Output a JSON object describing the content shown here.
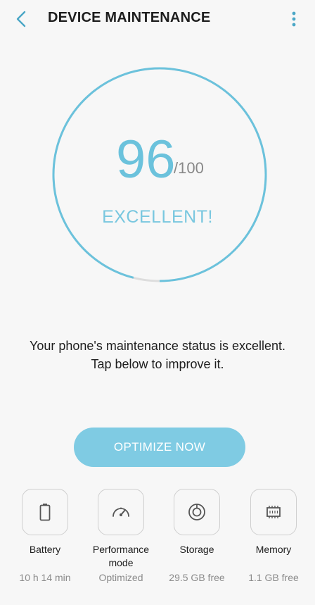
{
  "header": {
    "title": "DEVICE MAINTENANCE",
    "back_icon": "chevron-left-icon",
    "more_icon": "more-vert-icon"
  },
  "score": {
    "value": "96",
    "max": "/100",
    "progress": 0.96,
    "status": "EXCELLENT!"
  },
  "message": {
    "line1": "Your phone's maintenance status is excellent.",
    "line2": "Tap below to improve it."
  },
  "optimize_button": {
    "label": "OPTIMIZE NOW"
  },
  "tiles": [
    {
      "icon": "battery-icon",
      "label": "Battery",
      "value": "10 h 14 min"
    },
    {
      "icon": "speedometer-icon",
      "label": "Performance mode",
      "value": "Optimized"
    },
    {
      "icon": "storage-disc-icon",
      "label": "Storage",
      "value": "29.5 GB free"
    },
    {
      "icon": "memory-chip-icon",
      "label": "Memory",
      "value": "1.1 GB free"
    }
  ],
  "colors": {
    "accent": "#6bc2dc",
    "button": "#7fcbe3",
    "track": "#dddddd",
    "background": "#f7f7f7"
  }
}
